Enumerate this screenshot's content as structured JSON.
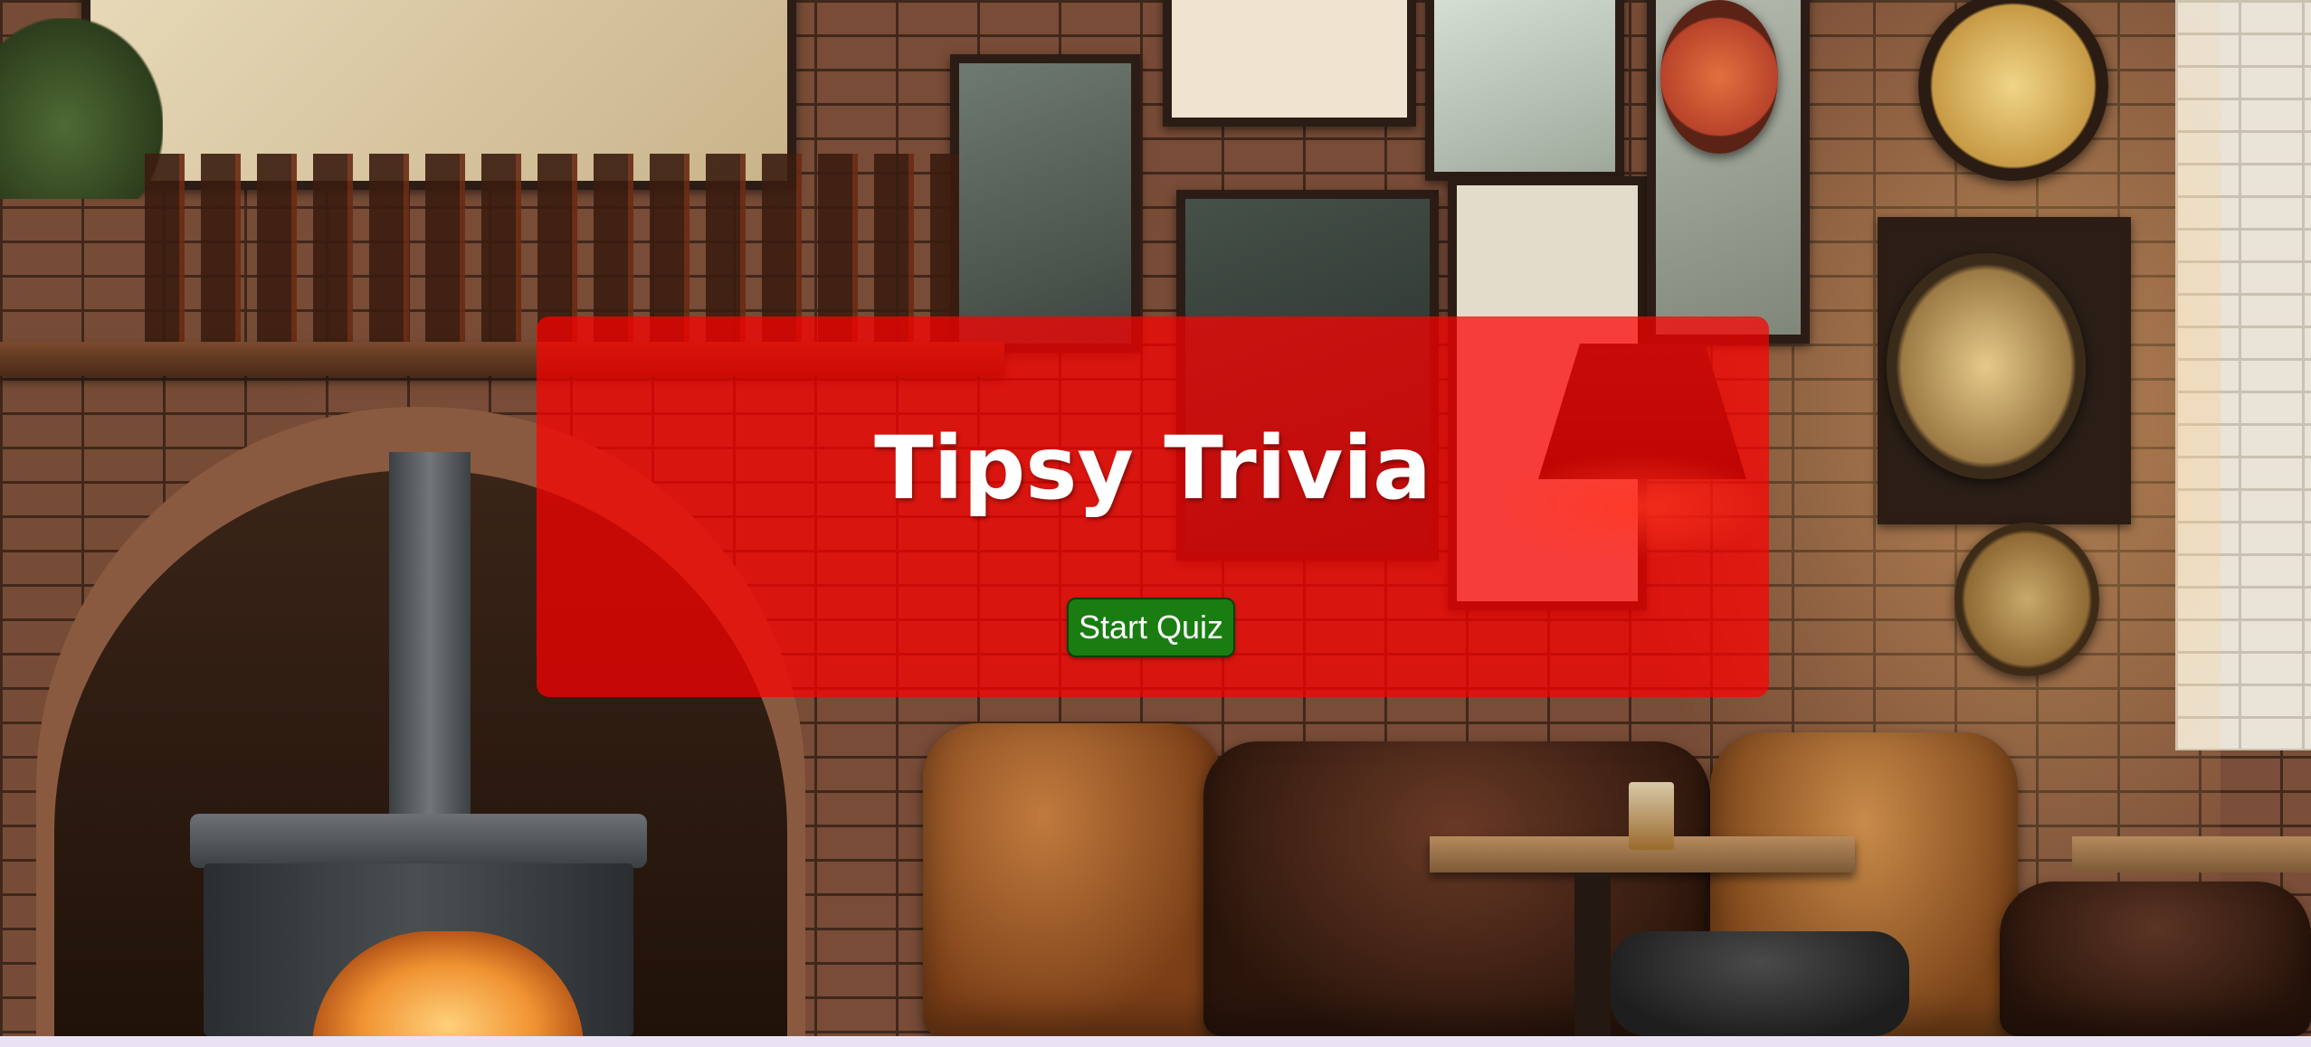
{
  "page": {
    "title": "Tipsy Trivia"
  },
  "hero": {
    "title": "Tipsy Trivia",
    "start_button_label": "Start Quiz"
  },
  "theme": {
    "panel_color": "#ff0000",
    "button_color": "#1a7d12",
    "text_color": "#ffffff"
  },
  "background": {
    "image_description_icon": "pub-interior-background"
  }
}
